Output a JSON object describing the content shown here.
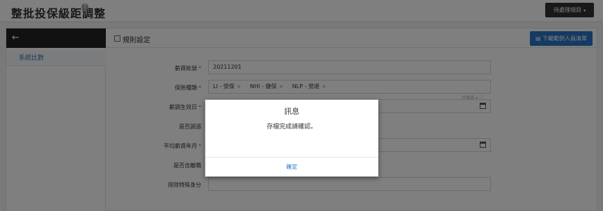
{
  "header": {
    "title": "整批投保級距調整",
    "help_icon": "question-circle-icon",
    "pending_label": "待處理項目",
    "pending_caret": "▾"
  },
  "sidebar": {
    "back_icon": "arrow-left-icon",
    "items": [
      {
        "label": "系統比對"
      }
    ]
  },
  "section": {
    "icon": "checkbox-icon",
    "title": "規則設定",
    "download_label": "下載範例人員清單"
  },
  "form": {
    "batch_no": {
      "label": "薪資批號",
      "value": "20211201"
    },
    "insurance_type": {
      "label": "保險種類",
      "tags": [
        "LI - 勞保",
        "NHI - 健保",
        "NLP - 勞退"
      ],
      "hint": "可複選 ▾ ⓘ"
    },
    "effective_date": {
      "label": "薪調生效日",
      "value": ""
    },
    "is_rounding": {
      "label": "是否調漲"
    },
    "avg_salary_month": {
      "label": "平均薪資年月",
      "value": ""
    },
    "include_resigned": {
      "label": "是否含離職"
    },
    "exclude_identity": {
      "label": "排除特殊身分",
      "value": ""
    }
  },
  "modal": {
    "title": "訊息",
    "message": "存檔完成請確認。",
    "ok_label": "確定"
  },
  "colors": {
    "primary": "#2a74c7",
    "required": "#d9534f",
    "dark": "#222222"
  }
}
